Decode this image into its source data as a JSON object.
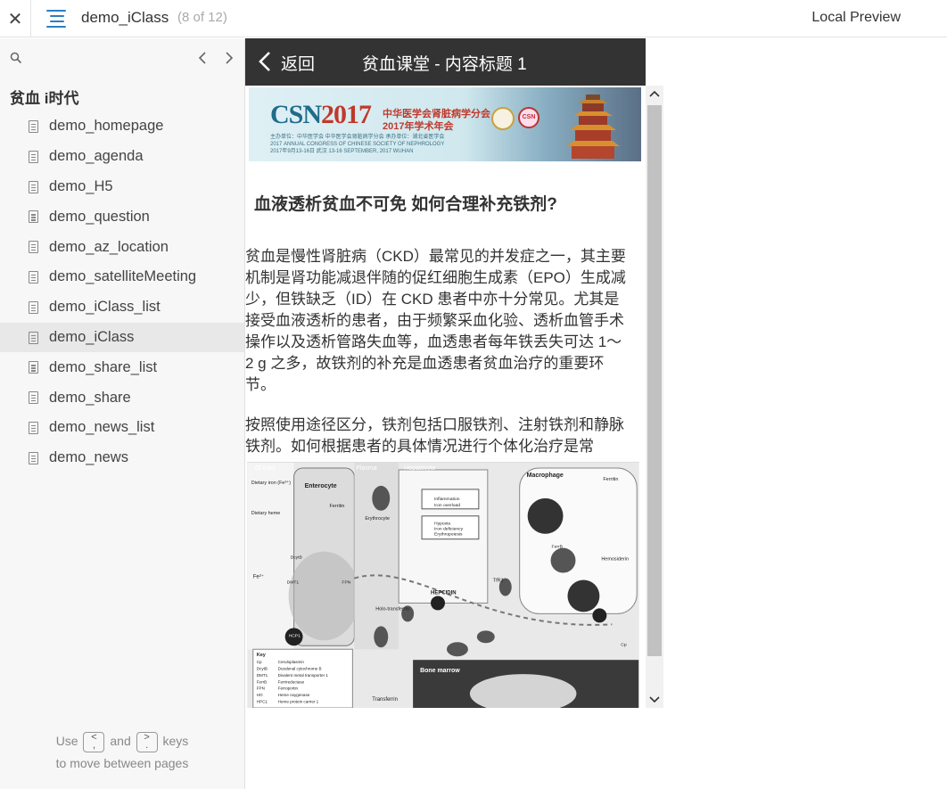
{
  "topbar": {
    "close_glyph": "✕",
    "menu_icon": "menu-icon",
    "app_title": "demo_iClass",
    "page_count": "(8 of 12)",
    "local_preview": "Local Preview"
  },
  "sidebar": {
    "search_icon": "search-icon",
    "prev_glyph": "‹",
    "next_glyph": "›",
    "group_title": "贫血 i时代",
    "active_index": 7,
    "items": [
      {
        "label": "demo_homepage"
      },
      {
        "label": "demo_agenda"
      },
      {
        "label": "demo_H5"
      },
      {
        "label": "demo_question"
      },
      {
        "label": "demo_az_location"
      },
      {
        "label": "demo_satelliteMeeting"
      },
      {
        "label": "demo_iClass_list"
      },
      {
        "label": "demo_iClass"
      },
      {
        "label": "demo_share_list"
      },
      {
        "label": "demo_share"
      },
      {
        "label": "demo_news_list"
      },
      {
        "label": "demo_news"
      }
    ],
    "hint": {
      "use": "Use",
      "key_prev_top": "<",
      "key_prev_bottom": ",",
      "and": "and",
      "key_next_top": ">",
      "key_next_bottom": ".",
      "keys": "keys",
      "line2": "to move between pages"
    }
  },
  "phone": {
    "back_label": "返回",
    "title": "贫血课堂 - 内容标题 1",
    "banner": {
      "csn": "CSN",
      "year": "2017",
      "sub1": "中华医学会肾脏病学分会",
      "sub2": "2017年学术年会",
      "tiny": "主办单位：中华医学会 中华医学会肾脏病学分会 承办单位：湖北省医学会 2017 ANNUAL CONGRESS OF CHINESE SOCIETY OF NEPHROLOGY 2017年9月13-16日 武汉 13-16 SEPTEMBER, 2017 WUHAN",
      "seal2": "CSN"
    },
    "article_title": "血液透析贫血不可免 如何合理补充铁剂?",
    "paragraph1": "贫血是慢性肾脏病（CKD）最常见的并发症之一，其主要机制是肾功能减退伴随的促红细胞生成素（EPO）生成减少，但铁缺乏（ID）在 CKD 患者中亦十分常见。尤其是接受血液透析的患者，由于频繁采血化验、透析血管手术操作以及透析管路失血等，血透患者每年铁丢失可达 1～2 g 之多，故铁剂的补充是血透患者贫血治疗的重要环节。",
    "paragraph2": "按照使用途径区分，铁剂包括口服铁剂、注射铁剂和静脉铁剂。如何根据患者的具体情况进行个体化治疗是常",
    "diagram": {
      "gi_tract": "GI tract",
      "plasma": "Plasma",
      "hepatocyte": "Hepatocyte",
      "macrophage": "Macrophage",
      "enterocyte": "Enterocyte",
      "dietary_iron": "Dietary iron (Fe³⁺)",
      "dietary_heme": "Dietary heme",
      "ferritin": "Ferritin",
      "erythrocyte": "Erythrocyte",
      "inflammation": "Inflammation",
      "iron_overload": "Iron overload",
      "hypoxia": "Hypoxia",
      "iron_deficiency": "Iron deficiency",
      "erythropoiesis": "Erythropoiesis",
      "hepcidin": "HEPCIDIN",
      "tfr1": "TfR1",
      "holo_transferrin": "Holo-transferrin",
      "hemosiderin": "Hemosiderin",
      "fpn": "FPN",
      "dmt1": "DMT1",
      "dcytb": "DcytB",
      "hcp1": "HCP1",
      "ferrb": "FerrB",
      "cp": "Cp",
      "bone_marrow": "Bone marrow",
      "transferrin": "Transferrin",
      "fe2": "Fe²⁺",
      "key_title": "Key",
      "key_items": [
        [
          "Cp",
          "Ceruloplasmin"
        ],
        [
          "DcytB",
          "Duodenal cytochrome B"
        ],
        [
          "DMT1",
          "Divalent metal transporter 1"
        ],
        [
          "FerrB",
          "Ferrireductase"
        ],
        [
          "FPN",
          "Ferroportin"
        ],
        [
          "HO",
          "Heme oxygenase"
        ],
        [
          "HPC1",
          "Heme protein carrier 1"
        ]
      ]
    }
  }
}
